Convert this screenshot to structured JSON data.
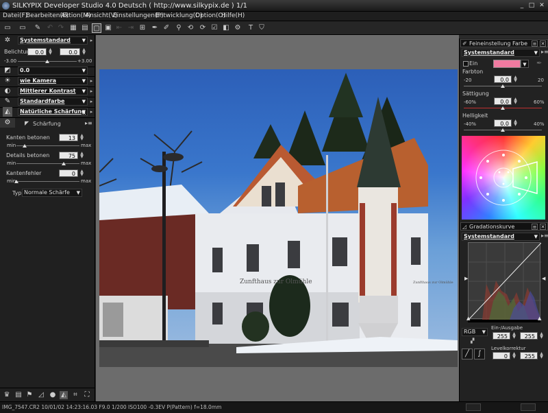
{
  "window": {
    "title": "SILKYPIX Developer Studio 4.0 Deutsch ( http://www.silkypix.de )   1/1",
    "minimize": "_",
    "maximize": "□",
    "close": "✕"
  },
  "menu": [
    {
      "label": "Datei(F)"
    },
    {
      "label": "Bearbeiten(E)"
    },
    {
      "label": "Aktion(M)"
    },
    {
      "label": "Ansicht(V)"
    },
    {
      "label": "Einstellungen(P)"
    },
    {
      "label": "Entwicklung(D)"
    },
    {
      "label": "Option(O)"
    },
    {
      "label": "Hilfe(H)"
    }
  ],
  "left_panel": {
    "preset": "Systemstandard",
    "exposure_label": "Belichtung",
    "exposure_value1": "0.0",
    "exposure_value2": "0.0",
    "exposure_min": "-3.00",
    "exposure_max": "+3.00",
    "exposure_level": 0.5,
    "white_balance_value": "0.0",
    "camera": "wie Kamera",
    "contrast": "Mittlerer Kontrast",
    "color": "Standardfarbe",
    "sharpness": "Natürliche Schärfung",
    "sharpen_section": "Schärfung",
    "edge_label": "Kanten betonen",
    "edge_value": "13",
    "edge_level": 0.13,
    "detail_label": "Details betonen",
    "detail_value": "75",
    "detail_level": 0.75,
    "edge_error_label": "Kantenfehler",
    "edge_error_value": "0",
    "edge_error_level": 0.0,
    "min": "min",
    "max": "max",
    "type_label": "Typ",
    "type_value": "Normale Schärfe"
  },
  "right_panel": {
    "fine_color_title": "Feineinstellung Farbe",
    "fine_preset": "Systemstandard",
    "on_label": "Ein",
    "swatch_color": "#f07aa0",
    "hue_label": "Farbton",
    "hue_min": "-20",
    "hue_max": "20",
    "hue_value": "0.0",
    "hue_level": 0.5,
    "sat_label": "Sättigung",
    "sat_min": "-60%",
    "sat_max": "60%",
    "sat_value": "0.0",
    "sat_level": 0.5,
    "light_label": "Helligkeit",
    "light_min": "-40%",
    "light_max": "40%",
    "light_value": "0.0",
    "light_level": 0.5,
    "tone_title": "Gradationskurve",
    "tone_preset": "Systemstandard",
    "channel": "RGB",
    "io_label": "Ein-/Ausgabe",
    "io_in": "255",
    "io_out": "255",
    "level_label": "Levelkorrektur",
    "level_low": "0",
    "level_high": "255"
  },
  "status": {
    "text": "IMG_7547.CR2 10/01/02 14:23:16.03 F9.0 1/200 ISO100 -0.3EV P(Pattern) f=18.0mm"
  },
  "photo": {
    "sign_text": "Zunfthaus zur Olmühle",
    "sign_text2": "Zunfthaus zur Olmühle"
  },
  "colors": {
    "accent_bar": "#c03030",
    "sky": "#3a77cc"
  }
}
